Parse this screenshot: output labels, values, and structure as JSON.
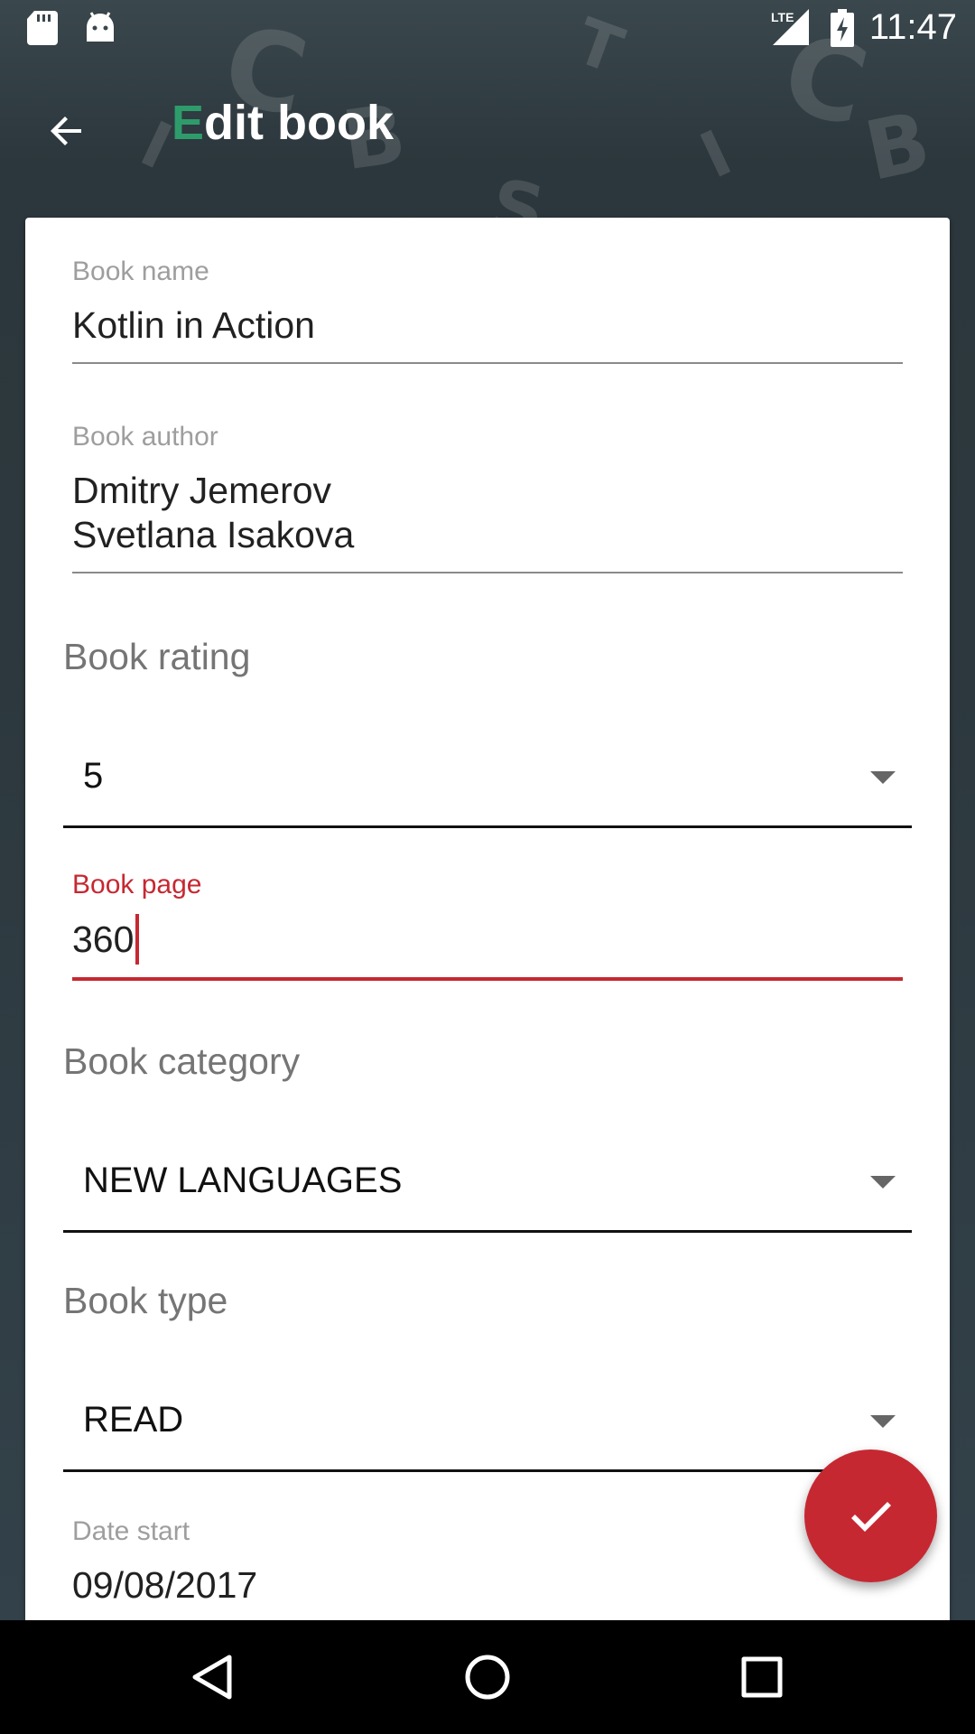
{
  "status_bar": {
    "time": "11:47",
    "network": "LTE",
    "icons": [
      "sd-card-icon",
      "android-icon",
      "lte-signal-icon",
      "battery-charging-icon"
    ]
  },
  "toolbar": {
    "title_first": "E",
    "title_rest": "dit book",
    "back_icon": "arrow-back-icon"
  },
  "form": {
    "book_name": {
      "label": "Book name",
      "value": "Kotlin in Action"
    },
    "book_author": {
      "label": "Book author",
      "value": "Dmitry Jemerov\nSvetlana Isakova"
    },
    "book_rating": {
      "label": "Book rating",
      "selected": "5"
    },
    "book_page": {
      "label": "Book page",
      "value": "360"
    },
    "book_category": {
      "label": "Book category",
      "selected": "NEW LANGUAGES"
    },
    "book_type": {
      "label": "Book type",
      "selected": "READ"
    },
    "date_start": {
      "label": "Date start",
      "value": "09/08/2017"
    }
  },
  "fab": {
    "icon": "check-icon"
  },
  "nav_bar": {
    "icons": [
      "back-triangle-icon",
      "home-circle-icon",
      "recents-square-icon"
    ]
  },
  "colors": {
    "accent": "#c62832",
    "title_accent": "#2e9b6b",
    "toolbar_bg": "#2f3b40"
  }
}
